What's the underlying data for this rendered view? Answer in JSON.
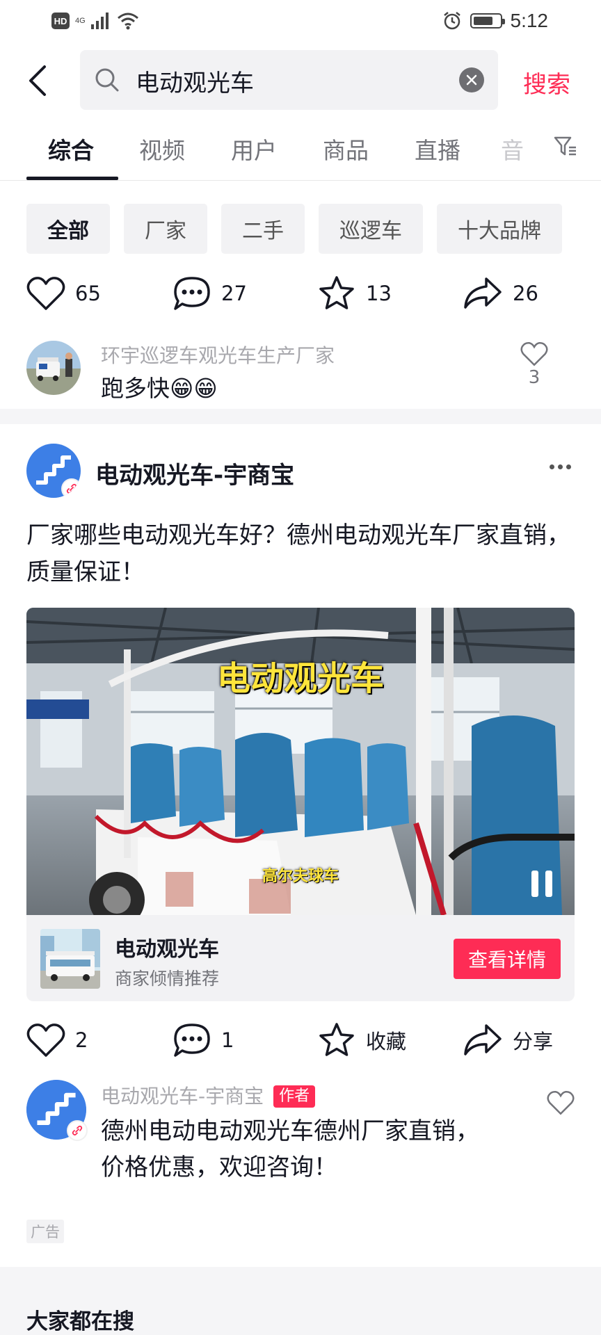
{
  "status_bar": {
    "hd": "HD",
    "network": "4G",
    "time": "5:12",
    "battery_level": 0.75
  },
  "search": {
    "query": "电动观光车",
    "submit_label": "搜索"
  },
  "tabs": [
    {
      "label": "综合",
      "active": true
    },
    {
      "label": "视频"
    },
    {
      "label": "用户"
    },
    {
      "label": "商品"
    },
    {
      "label": "直播"
    },
    {
      "label": "音"
    }
  ],
  "chips": [
    {
      "label": "全部",
      "active": true
    },
    {
      "label": "厂家"
    },
    {
      "label": "二手"
    },
    {
      "label": "巡逻车"
    },
    {
      "label": "十大品牌"
    }
  ],
  "previous_post": {
    "likes": "65",
    "comments": "27",
    "favorites": "13",
    "shares": "26",
    "top_comment": {
      "author": "环宇巡逻车观光车生产厂家",
      "text": "跑多快😁😁",
      "likes": "3"
    }
  },
  "ad_post": {
    "author": "电动观光车-宇商宝",
    "description": "厂家哪些电动观光车好？德州电动观光车厂家直销，质量保证！",
    "video": {
      "title_overlay": "电动观光车",
      "caption": "高尔夫球车"
    },
    "product": {
      "name": "电动观光车",
      "subtitle": "商家倾情推荐",
      "button_label": "查看详情"
    },
    "actions": {
      "likes": "2",
      "comments": "1",
      "favorite_label": "收藏",
      "share_label": "分享"
    },
    "top_comment": {
      "author": "电动观光车-宇商宝",
      "badge": "作者",
      "text_line1": "德州电动电动观光车德州厂家直销，",
      "text_line2": "价格优惠，欢迎咨询！"
    },
    "ad_label": "广告"
  },
  "trending": {
    "title": "大家都在搜"
  },
  "colors": {
    "accent": "#fe2c55",
    "text_primary": "#161823",
    "text_secondary": "#73747a",
    "chip_bg": "#f2f2f4",
    "avatar_blue": "#3d7fe6",
    "video_title": "#ffe53b"
  }
}
